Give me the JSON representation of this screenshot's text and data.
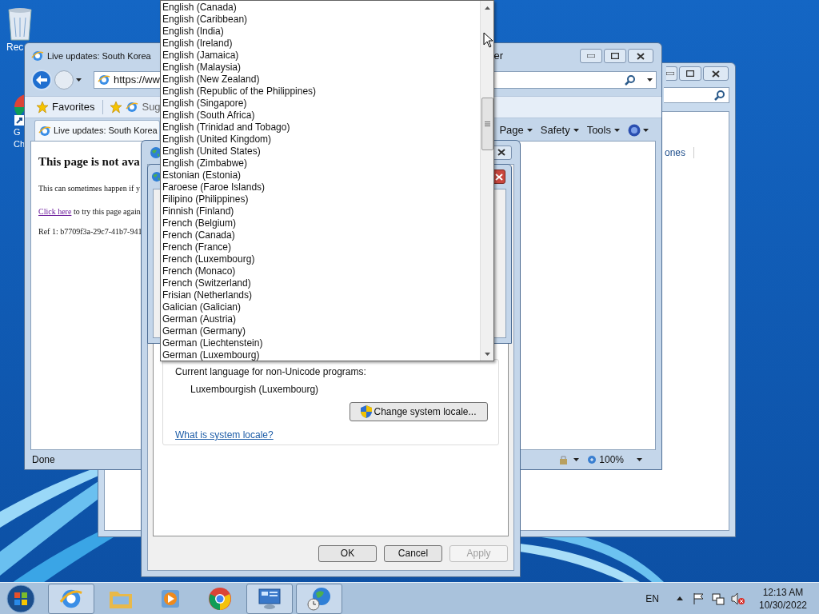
{
  "desktop_icons": [
    {
      "kind": "bin",
      "lines": [
        "Rec"
      ]
    },
    {
      "kind": "chrome",
      "lines": [
        "G",
        "Ch"
      ]
    }
  ],
  "back_window": {
    "text": "ones"
  },
  "browser": {
    "title": "Live updates: South Korea",
    "title_end": "er",
    "address": "https://ww",
    "favorites": "Favorites",
    "suggested": "Sug",
    "tab": "Live updates: South Korea",
    "commands": [
      "Page",
      "Safety",
      "Tools"
    ],
    "page": {
      "heading": "This page is not ava",
      "line": "This can sometimes happen if y",
      "link": "Click here",
      "link_rest": " to try this page again",
      "ref": "Ref 1: b7709f3a-29c7-41b7-941"
    },
    "status": "Done",
    "zoom": "100%"
  },
  "dialog": {
    "group_label": "Current language for non-Unicode programs:",
    "current_language": "Luxembourgish (Luxembourg)",
    "change_button": "Change system locale...",
    "help_link": "What is system locale?",
    "buttons": [
      {
        "label": "OK",
        "disabled": false
      },
      {
        "label": "Cancel",
        "disabled": false
      },
      {
        "label": "Apply",
        "disabled": true
      }
    ]
  },
  "dropdown": {
    "items": [
      {
        "label": "English (Canada)",
        "selected": false
      },
      {
        "label": "English (Caribbean)",
        "selected": false
      },
      {
        "label": "English (India)",
        "selected": false
      },
      {
        "label": "English (Ireland)",
        "selected": false
      },
      {
        "label": "English (Jamaica)",
        "selected": false
      },
      {
        "label": "English (Malaysia)",
        "selected": false
      },
      {
        "label": "English (New Zealand)",
        "selected": false
      },
      {
        "label": "English (Republic of the Philippines)",
        "selected": false
      },
      {
        "label": "English (Singapore)",
        "selected": false
      },
      {
        "label": "English (South Africa)",
        "selected": false
      },
      {
        "label": "English (Trinidad and Tobago)",
        "selected": false
      },
      {
        "label": "English (United Kingdom)",
        "selected": false
      },
      {
        "label": "English (United States)",
        "selected": false
      },
      {
        "label": "English (Zimbabwe)",
        "selected": false
      },
      {
        "label": "Estonian (Estonia)",
        "selected": false
      },
      {
        "label": "Faroese (Faroe Islands)",
        "selected": false
      },
      {
        "label": "Filipino (Philippines)",
        "selected": false
      },
      {
        "label": "Finnish (Finland)",
        "selected": false
      },
      {
        "label": "French (Belgium)",
        "selected": false
      },
      {
        "label": "French (Canada)",
        "selected": false
      },
      {
        "label": "French (France)",
        "selected": false
      },
      {
        "label": "French (Luxembourg)",
        "selected": false
      },
      {
        "label": "French (Monaco)",
        "selected": false
      },
      {
        "label": "French (Switzerland)",
        "selected": false
      },
      {
        "label": "Frisian (Netherlands)",
        "selected": false
      },
      {
        "label": "Galician (Galician)",
        "selected": false
      },
      {
        "label": "German (Austria)",
        "selected": false
      },
      {
        "label": "German (Germany)",
        "selected": false
      },
      {
        "label": "German (Liechtenstein)",
        "selected": false
      },
      {
        "label": "German (Luxembourg)",
        "selected": false
      }
    ]
  },
  "taskbar": {
    "items": [
      {
        "kind": "ie",
        "running": true
      },
      {
        "kind": "folder",
        "running": false
      },
      {
        "kind": "media",
        "running": false
      },
      {
        "kind": "chrome",
        "running": false
      },
      {
        "kind": "control",
        "running": true
      },
      {
        "kind": "globe",
        "running": true
      }
    ],
    "language": "EN",
    "time": "12:13 AM",
    "date": "10/30/2022"
  }
}
